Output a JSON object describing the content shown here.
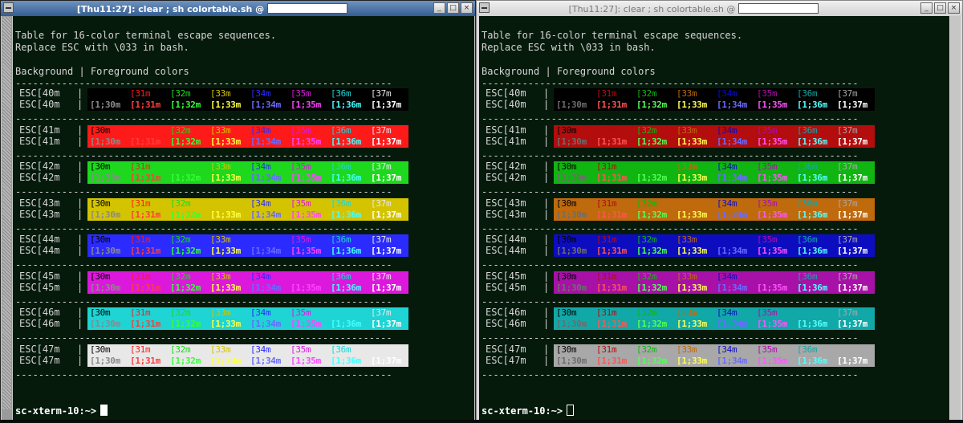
{
  "palettes": {
    "left": [
      "#000000",
      "#ff1a1a",
      "#1ed81e",
      "#d4c400",
      "#2b2bff",
      "#dd18dd",
      "#1ed4d4",
      "#e8e8e8"
    ],
    "right": [
      "#000000",
      "#b30d0d",
      "#11b511",
      "#bf6a0d",
      "#0d0dc0",
      "#a811a8",
      "#11a8a8",
      "#a8a8a8"
    ],
    "left_bold": [
      "#8a8a8a",
      "#ff3d3d",
      "#33ff33",
      "#ffff44",
      "#6a6aff",
      "#ff44ff",
      "#44ffff",
      "#ffffff"
    ],
    "right_bold": [
      "#6d6d6d",
      "#ff5454",
      "#54ff54",
      "#ffff54",
      "#6b6bff",
      "#ff54ff",
      "#54ffff",
      "#ffffff"
    ]
  },
  "term_bg": "#061a0c",
  "windows": [
    {
      "key": "left",
      "title": "[Thu11:27]: clear ; sh colortable.sh @",
      "buttons": [
        "_",
        "□",
        "×"
      ],
      "focused": true
    },
    {
      "key": "right",
      "title": "[Thu11:27]: clear ; sh colortable.sh @",
      "buttons": [
        "_",
        "□",
        "×"
      ],
      "focused": false
    }
  ],
  "terminal": {
    "line1": "Table for 16-color terminal escape sequences.",
    "line2": "Replace ESC with \\033 in bash.",
    "header": "Background | Foreground colors",
    "separator": "-----------------------------------------------------------------",
    "bar": "|",
    "prompt": "sc-xterm-10:~>"
  },
  "table": {
    "bg_labels": [
      "ESC[40m",
      "ESC[41m",
      "ESC[42m",
      "ESC[43m",
      "ESC[44m",
      "ESC[45m",
      "ESC[46m",
      "ESC[47m"
    ],
    "fg_normal": [
      "[30m",
      "[31m",
      "[32m",
      "[33m",
      "[34m",
      "[35m",
      "[36m",
      "[37m"
    ],
    "fg_bold": [
      "[1;30m",
      "[1;31m",
      "[1;32m",
      "[1;33m",
      "[1;34m",
      "[1;35m",
      "[1;36m",
      "[1;37m"
    ]
  }
}
